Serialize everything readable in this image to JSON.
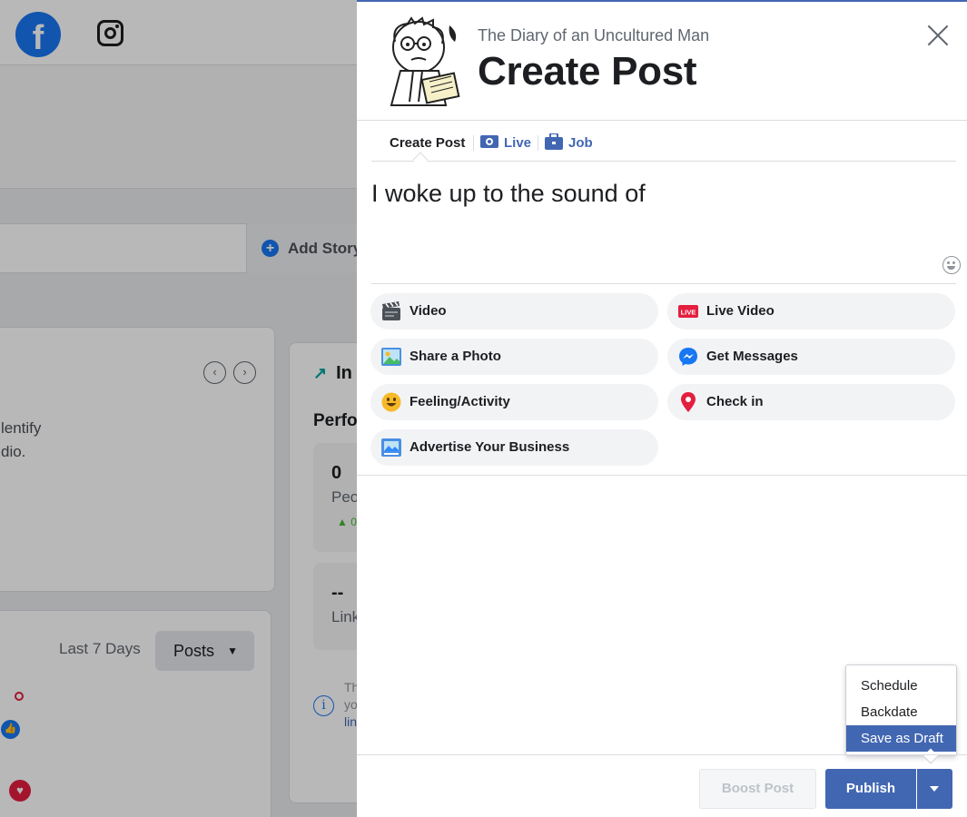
{
  "background": {
    "add_story_label": "Add Story",
    "card1_text_line1": "lentify",
    "card1_text_line2": "dio.",
    "card2_title": "In",
    "card2_subtitle": "Perfo",
    "stat1_number": "0",
    "stat1_label": "Peo",
    "stat1_change": "▲ 0",
    "stat2_number": "--",
    "stat2_label": "Link",
    "info_lines": [
      "Th",
      "yo",
      "lin"
    ],
    "date_range_label": "Last 7 Days",
    "posts_filter_label": "Posts"
  },
  "panel": {
    "page_name": "The Diary of an Uncultured Man",
    "title": "Create Post",
    "tabs": [
      {
        "label": "Create Post"
      },
      {
        "label": "Live"
      },
      {
        "label": "Job"
      }
    ],
    "composer_text": "I woke up to the sound of",
    "actions": [
      {
        "label": "Video",
        "icon": "clapperboard-icon"
      },
      {
        "label": "Live Video",
        "icon": "live-badge-icon"
      },
      {
        "label": "Share a Photo",
        "icon": "photo-icon"
      },
      {
        "label": "Get Messages",
        "icon": "messenger-icon"
      },
      {
        "label": "Feeling/Activity",
        "icon": "smiley-icon"
      },
      {
        "label": "Check in",
        "icon": "location-pin-icon"
      },
      {
        "label": "Advertise Your Business",
        "icon": "advertise-icon"
      }
    ],
    "footer": {
      "boost_label": "Boost Post",
      "publish_label": "Publish"
    },
    "publish_menu": {
      "items": [
        {
          "label": "Schedule"
        },
        {
          "label": "Backdate"
        },
        {
          "label": "Save as Draft",
          "active": true
        }
      ]
    }
  },
  "colors": {
    "facebook_blue": "#1877f2",
    "primary_button": "#4267b2",
    "live_red": "#e41e3f"
  }
}
